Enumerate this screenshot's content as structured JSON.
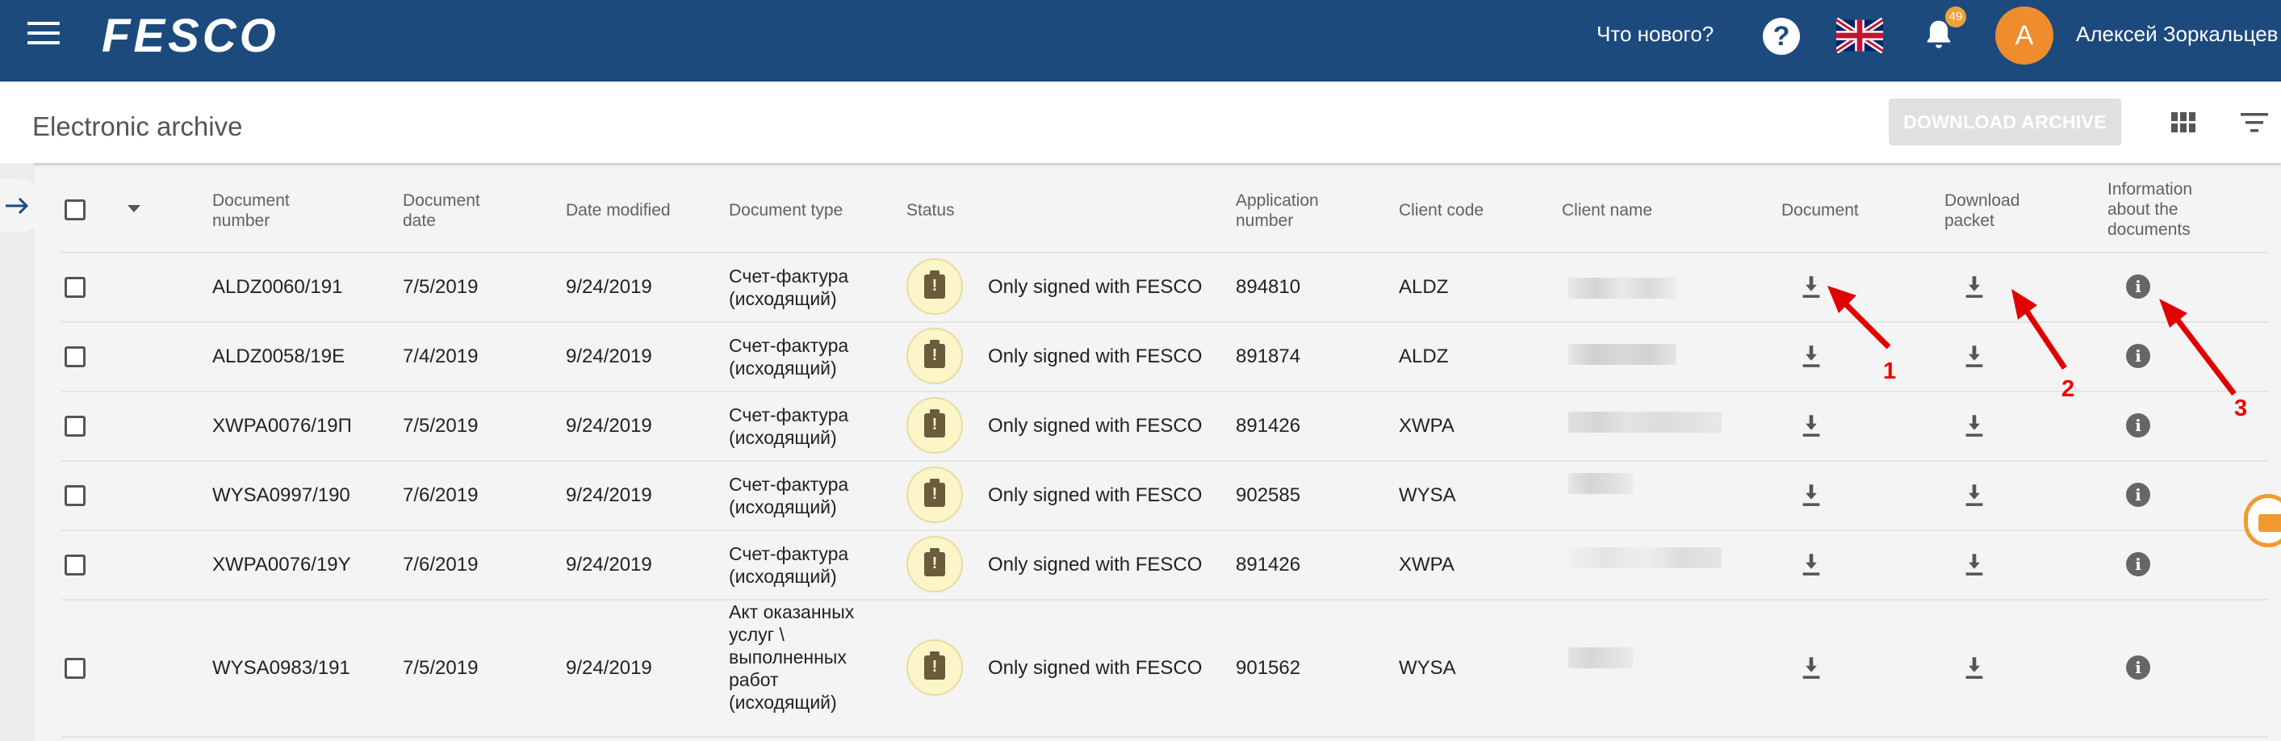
{
  "header": {
    "whats_new": "Что нового?",
    "help": "?",
    "notifications_count": "49",
    "avatar_letter": "А",
    "user_name": "Алексей Зоркальцев",
    "logo": "FESCO"
  },
  "page": {
    "title": "Electronic archive",
    "download_archive": "DOWNLOAD ARCHIVE"
  },
  "columns": {
    "doc_number": "Document number",
    "doc_date": "Document date",
    "date_modified": "Date modified",
    "doc_type": "Document type",
    "status": "Status",
    "app_number": "Application number",
    "client_code": "Client code",
    "client_name": "Client name",
    "document": "Document",
    "download_packet": "Download packet",
    "info": "Information about the documents"
  },
  "rows": [
    {
      "doc_number": "ALDZ0060/191",
      "doc_date": "7/5/2019",
      "date_modified": "9/24/2019",
      "doc_type": "Счет-фактура (исходящий)",
      "status": "Only signed with FESCO",
      "app_number": "894810",
      "client_code": "ALDZ"
    },
    {
      "doc_number": "ALDZ0058/19E",
      "doc_date": "7/4/2019",
      "date_modified": "9/24/2019",
      "doc_type": "Счет-фактура (исходящий)",
      "status": "Only signed with FESCO",
      "app_number": "891874",
      "client_code": "ALDZ"
    },
    {
      "doc_number": "XWPA0076/19П",
      "doc_date": "7/5/2019",
      "date_modified": "9/24/2019",
      "doc_type": "Счет-фактура (исходящий)",
      "status": "Only signed with FESCO",
      "app_number": "891426",
      "client_code": "XWPA"
    },
    {
      "doc_number": "WYSA0997/190",
      "doc_date": "7/6/2019",
      "date_modified": "9/24/2019",
      "doc_type": "Счет-фактура (исходящий)",
      "status": "Only signed with FESCO",
      "app_number": "902585",
      "client_code": "WYSA"
    },
    {
      "doc_number": "XWPA0076/19Y",
      "doc_date": "7/6/2019",
      "date_modified": "9/24/2019",
      "doc_type": "Счет-фактура (исходящий)",
      "status": "Only signed with FESCO",
      "app_number": "891426",
      "client_code": "XWPA"
    },
    {
      "doc_number": "WYSA0983/191",
      "doc_date": "7/5/2019",
      "date_modified": "9/24/2019",
      "doc_type": "Акт оказанных услуг \\ выполненных работ (исходящий)",
      "status": "Only signed with FESCO",
      "app_number": "901562",
      "client_code": "WYSA"
    }
  ],
  "annotations": [
    "1",
    "2",
    "3"
  ],
  "colors": {
    "header_bg": "#1d4a7d",
    "accent": "#ef8c2b",
    "annotation": "#e00000",
    "status_bg": "#fbf5c8"
  },
  "icons": {
    "menu": "hamburger-icon",
    "help": "help-icon",
    "lang": "uk-flag-icon",
    "notif": "bell-icon",
    "grid": "grid-view-icon",
    "filter": "filter-icon",
    "download": "download-icon",
    "info": "info-icon",
    "status": "clipboard-alert-icon",
    "expand": "arrow-right-icon",
    "chat": "mail-icon"
  }
}
